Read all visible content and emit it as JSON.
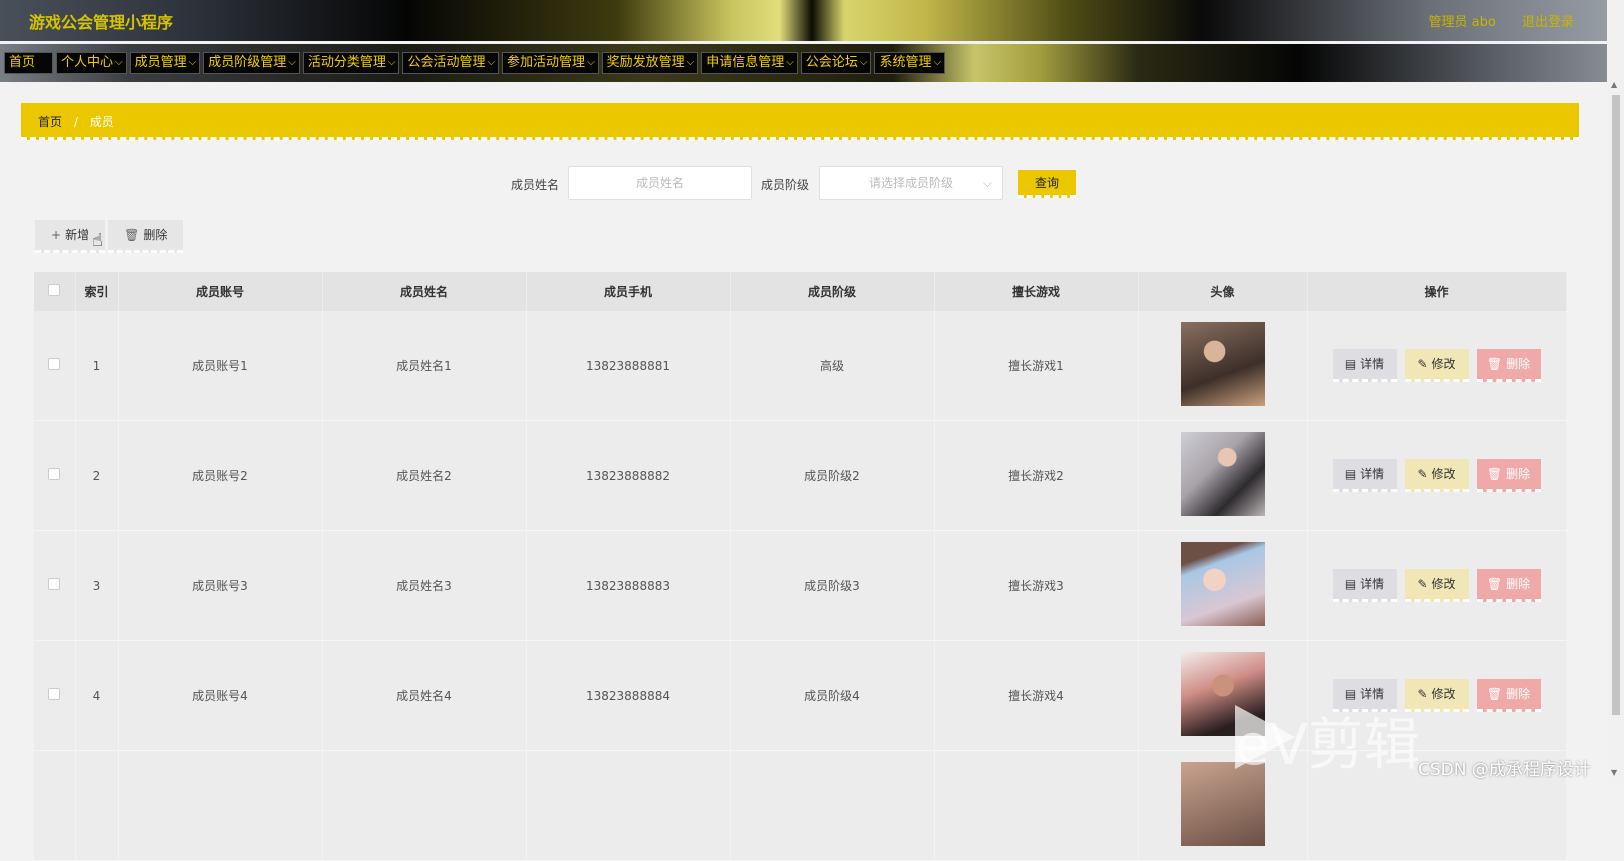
{
  "header": {
    "title": "游戏公会管理小程序",
    "user": "管理员 abo",
    "logout": "退出登录"
  },
  "nav": [
    {
      "label": "首页",
      "has_menu": false
    },
    {
      "label": "个人中心",
      "has_menu": true
    },
    {
      "label": "成员管理",
      "has_menu": true
    },
    {
      "label": "成员阶级管理",
      "has_menu": true
    },
    {
      "label": "活动分类管理",
      "has_menu": true
    },
    {
      "label": "公会活动管理",
      "has_menu": true
    },
    {
      "label": "参加活动管理",
      "has_menu": true
    },
    {
      "label": "奖励发放管理",
      "has_menu": true
    },
    {
      "label": "申请信息管理",
      "has_menu": true
    },
    {
      "label": "公会论坛",
      "has_menu": true
    },
    {
      "label": "系统管理",
      "has_menu": true
    }
  ],
  "breadcrumb": {
    "home": "首页",
    "separator": "/",
    "current": "成员"
  },
  "search": {
    "name_label": "成员姓名",
    "name_placeholder": "成员姓名",
    "level_label": "成员阶级",
    "level_placeholder": "请选择成员阶级",
    "query_label": "查询"
  },
  "actions": {
    "add_label": "新增",
    "delete_label": "删除"
  },
  "table": {
    "columns": [
      "索引",
      "成员账号",
      "成员姓名",
      "成员手机",
      "成员阶级",
      "擅长游戏",
      "头像",
      "操作"
    ],
    "rows": [
      {
        "index": "1",
        "account": "成员账号1",
        "name": "成员姓名1",
        "phone": "13823888881",
        "level": "高级",
        "game": "擅长游戏1"
      },
      {
        "index": "2",
        "account": "成员账号2",
        "name": "成员姓名2",
        "phone": "13823888882",
        "level": "成员阶级2",
        "game": "擅长游戏2"
      },
      {
        "index": "3",
        "account": "成员账号3",
        "name": "成员姓名3",
        "phone": "13823888883",
        "level": "成员阶级3",
        "game": "擅长游戏3"
      },
      {
        "index": "4",
        "account": "成员账号4",
        "name": "成员姓名4",
        "phone": "13823888884",
        "level": "成员阶级4",
        "game": "擅长游戏4"
      }
    ],
    "row_actions": {
      "detail": "详情",
      "edit": "修改",
      "delete": "删除"
    }
  },
  "watermark": {
    "ev": "eV剪辑",
    "csdn": "CSDN @成承程序设计"
  },
  "colors": {
    "accent": "#ebc700",
    "delete": "#efa9a9",
    "edit": "#f1e7b6",
    "detail": "#dedee2"
  }
}
